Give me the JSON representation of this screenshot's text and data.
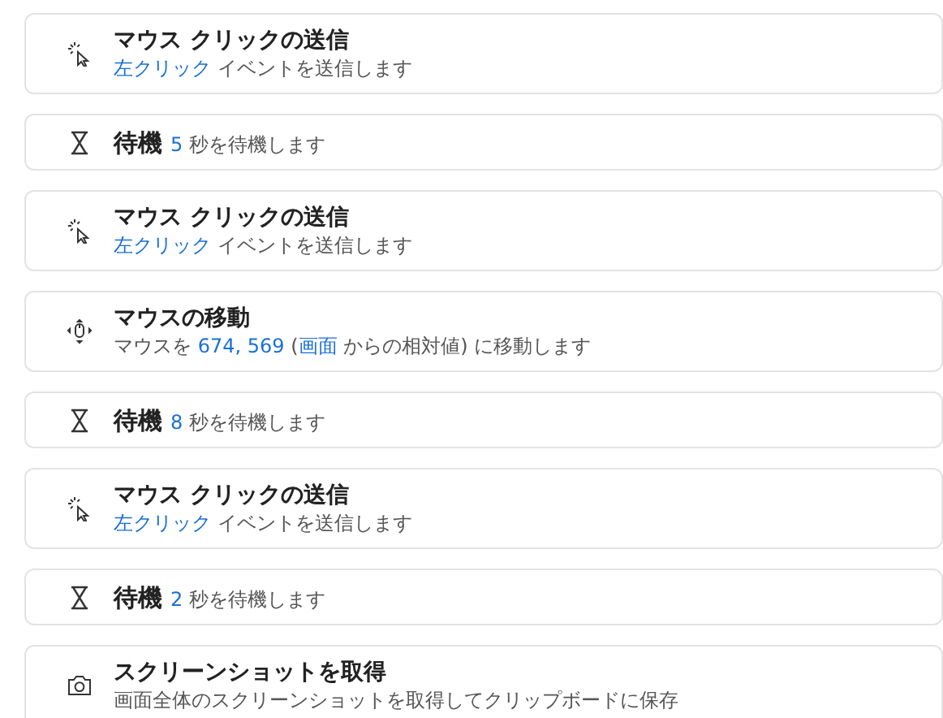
{
  "steps": [
    {
      "kind": "click",
      "title": "マウス クリックの送信",
      "description": [
        {
          "kind": "value",
          "text": "左クリック"
        },
        {
          "kind": "plain",
          "text": " イベントを送信します"
        }
      ]
    },
    {
      "kind": "wait",
      "title": "待機",
      "description": [
        {
          "kind": "value",
          "text": "5"
        },
        {
          "kind": "plain",
          "text": " 秒を待機します"
        }
      ]
    },
    {
      "kind": "click",
      "title": "マウス クリックの送信",
      "description": [
        {
          "kind": "value",
          "text": "左クリック"
        },
        {
          "kind": "plain",
          "text": " イベントを送信します"
        }
      ]
    },
    {
      "kind": "move",
      "title": "マウスの移動",
      "description": [
        {
          "kind": "plain",
          "text": "マウスを "
        },
        {
          "kind": "value",
          "text": "674, 569"
        },
        {
          "kind": "plain",
          "text": " ("
        },
        {
          "kind": "value",
          "text": "画面"
        },
        {
          "kind": "plain",
          "text": " からの相対値) に移動します"
        }
      ]
    },
    {
      "kind": "wait",
      "title": "待機",
      "description": [
        {
          "kind": "value",
          "text": "8"
        },
        {
          "kind": "plain",
          "text": " 秒を待機します"
        }
      ]
    },
    {
      "kind": "click",
      "title": "マウス クリックの送信",
      "description": [
        {
          "kind": "value",
          "text": "左クリック"
        },
        {
          "kind": "plain",
          "text": " イベントを送信します"
        }
      ]
    },
    {
      "kind": "wait",
      "title": "待機",
      "description": [
        {
          "kind": "value",
          "text": "2"
        },
        {
          "kind": "plain",
          "text": " 秒を待機します"
        }
      ]
    },
    {
      "kind": "screenshot",
      "title": "スクリーンショットを取得",
      "description": [
        {
          "kind": "plain",
          "text": "画面全体のスクリーンショットを取得してクリップボードに保存"
        }
      ]
    }
  ]
}
